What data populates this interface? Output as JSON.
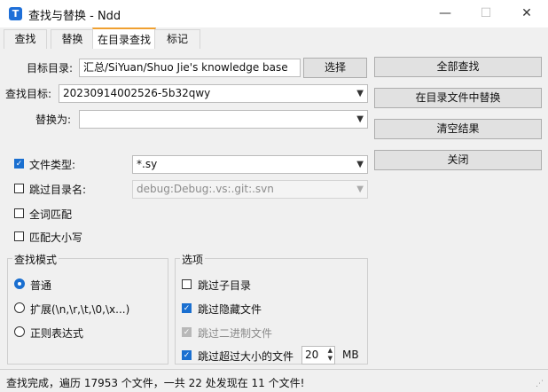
{
  "window": {
    "title": "查找与替换 - Ndd",
    "icon_letter": "T",
    "minimize": "—",
    "maximize": "☐",
    "close": "✕"
  },
  "tabs": [
    {
      "label": "查找",
      "active": false
    },
    {
      "label": "替换",
      "active": false
    },
    {
      "label": "在目录查找",
      "active": true
    },
    {
      "label": "标记",
      "active": false
    }
  ],
  "form": {
    "target_dir_label": "目标目录:",
    "target_dir_value": "汇总/SiYuan/Shuo Jie's knowledge base",
    "browse_button": "选择",
    "find_target_label": "查找目标:",
    "find_target_value": "20230914002526-5b32qwy",
    "replace_with_label": "替换为:",
    "replace_with_value": "",
    "file_type_label": "文件类型:",
    "file_type_value": "*.sy",
    "skip_dir_label": "跳过目录名:",
    "skip_dir_value": "debug:Debug:.vs:.git:.svn",
    "whole_word_label": "全词匹配",
    "match_case_label": "匹配大小写"
  },
  "checkboxes": {
    "file_type": true,
    "skip_dir": false,
    "whole_word": false,
    "match_case": false
  },
  "actions": {
    "find_all": "全部查找",
    "replace_in_files": "在目录文件中替换",
    "clear_results": "清空结果",
    "close": "关闭"
  },
  "search_mode": {
    "title": "查找模式",
    "options": [
      {
        "label": "普通",
        "selected": true
      },
      {
        "label": "扩展(\\n,\\r,\\t,\\0,\\x...)",
        "selected": false
      },
      {
        "label": "正则表达式",
        "selected": false
      }
    ]
  },
  "options": {
    "title": "选项",
    "skip_subdir": {
      "label": "跳过子目录",
      "checked": false
    },
    "skip_hidden": {
      "label": "跳过隐藏文件",
      "checked": true
    },
    "skip_binary": {
      "label": "跳过二进制文件",
      "checked": true,
      "disabled": true
    },
    "skip_large": {
      "label": "跳过超过大小的文件",
      "checked": true
    },
    "size_value": "20",
    "size_unit": "MB"
  },
  "status": {
    "text": "查找完成，遍历 17953 个文件，一共 22 处发现在 11 个文件!"
  },
  "colors": {
    "accent": "#1a6fd0",
    "tab_highlight": "#f0a030"
  }
}
